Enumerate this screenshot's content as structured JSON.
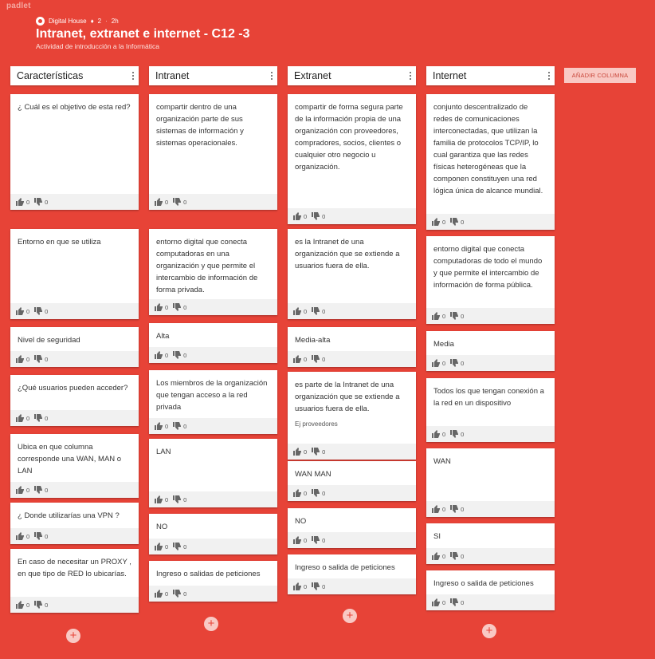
{
  "app": {
    "brand": "padlet"
  },
  "board": {
    "author": "Digital House",
    "likes": "2",
    "separator": "·",
    "time": "2h",
    "title": "Intranet, extranet e internet - C12 -3",
    "subtitle": "Actividad de introducción a la Informática",
    "add_column_label": "AÑADIR COLUMNA"
  },
  "columns": [
    {
      "title": "Características",
      "cards": [
        {
          "text": "¿ Cuál es el objetivo de esta red?",
          "likes": "0",
          "dislikes": "0"
        },
        {
          "text": "Entorno en que se utiliza",
          "likes": "0",
          "dislikes": "0"
        },
        {
          "text": "Nivel de seguridad",
          "likes": "0",
          "dislikes": "0"
        },
        {
          "text": "¿Qué usuarios pueden acceder?",
          "likes": "0",
          "dislikes": "0"
        },
        {
          "text": "Ubica en que columna corresponde una WAN, MAN o LAN",
          "likes": "0",
          "dislikes": "0"
        },
        {
          "text": "¿ Donde utilizarías una VPN ?",
          "likes": "0",
          "dislikes": "0"
        },
        {
          "text": "En caso de necesitar un PROXY , en que tipo de RED lo ubicarías.",
          "likes": "0",
          "dislikes": "0"
        }
      ]
    },
    {
      "title": "Intranet",
      "cards": [
        {
          "text": " compartir dentro de una organización parte de sus sistemas de información y sistemas operacionales.",
          "likes": "0",
          "dislikes": "0"
        },
        {
          "text": "entorno digital que conecta computadoras en una organización y que permite el intercambio de información de forma privada.",
          "likes": "0",
          "dislikes": "0"
        },
        {
          "text": "Alta",
          "likes": "0",
          "dislikes": "0"
        },
        {
          "text": "Los miembros de la organización que tengan acceso a la red privada",
          "likes": "0",
          "dislikes": "0"
        },
        {
          "text": "LAN",
          "likes": "0",
          "dislikes": "0"
        },
        {
          "text": "NO",
          "likes": "0",
          "dislikes": "0"
        },
        {
          "text": "Ingreso o salidas de peticiones",
          "likes": "0",
          "dislikes": "0"
        }
      ]
    },
    {
      "title": "Extranet",
      "cards": [
        {
          "text": "compartir de forma segura parte de la información propia de una organización con proveedores, compradores, socios, clientes o cualquier otro negocio u organización.",
          "likes": "0",
          "dislikes": "0"
        },
        {
          "text": "es la Intranet de una organización que se extiende a usuarios fuera de ella.",
          "likes": "0",
          "dislikes": "0"
        },
        {
          "text": "Media-alta",
          "likes": "0",
          "dislikes": "0"
        },
        {
          "text": "es parte de la Intranet de una organización que se extiende a usuarios fuera de ella.",
          "note": "Ej proveedores",
          "likes": "0",
          "dislikes": "0"
        },
        {
          "text": "WAN MAN",
          "likes": "0",
          "dislikes": "0"
        },
        {
          "text": "NO",
          "likes": "0",
          "dislikes": "0"
        },
        {
          "text": "Ingreso o salida de peticiones",
          "likes": "0",
          "dislikes": "0"
        }
      ]
    },
    {
      "title": "Internet",
      "cards": [
        {
          "text": "conjunto descentralizado de redes de comunicaciones interconectadas, que utilizan la familia de protocolos TCP/IP, lo cual garantiza que las redes físicas heterogéneas que la componen constituyen una red lógica única de alcance mundial.",
          "likes": "0",
          "dislikes": "0"
        },
        {
          "text": "entorno digital que conecta computadoras de todo el mundo y que permite el intercambio de información de forma pública.",
          "likes": "0",
          "dislikes": "0"
        },
        {
          "text": "Media",
          "likes": "0",
          "dislikes": "0"
        },
        {
          "text": "Todos los que tengan conexión a la red en un dispositivo",
          "likes": "0",
          "dislikes": "0"
        },
        {
          "text": "WAN",
          "likes": "0",
          "dislikes": "0"
        },
        {
          "text": "SI",
          "likes": "0",
          "dislikes": "0"
        },
        {
          "text": "Ingreso o salida de peticiones",
          "likes": "0",
          "dislikes": "0"
        }
      ]
    }
  ],
  "icons": {
    "like": "thumb-up-icon",
    "dislike": "thumb-down-icon",
    "menu": "more-vert-icon",
    "add": "plus-icon"
  },
  "colors": {
    "background": "#e74337",
    "add_button": "#f9c9c4"
  }
}
